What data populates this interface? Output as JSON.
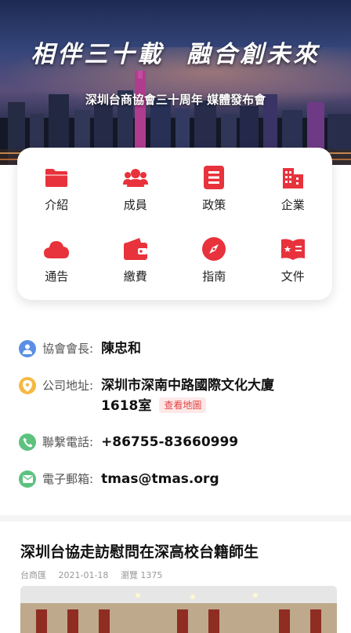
{
  "banner": {
    "title": "相伴三十載  融合創未來",
    "subtitle": "深圳台商協會三十周年 媒體發布會"
  },
  "menu": {
    "items": [
      {
        "label": "介紹",
        "icon": "folder-icon"
      },
      {
        "label": "成員",
        "icon": "members-icon"
      },
      {
        "label": "政策",
        "icon": "document-list-icon"
      },
      {
        "label": "企業",
        "icon": "building-icon"
      },
      {
        "label": "通告",
        "icon": "cloud-icon"
      },
      {
        "label": "繳費",
        "icon": "wallet-icon"
      },
      {
        "label": "指南",
        "icon": "compass-icon"
      },
      {
        "label": "文件",
        "icon": "book-icon"
      }
    ],
    "accent_color": "#e8323c"
  },
  "info": {
    "president_label": "協會會長:",
    "president_value": "陳忠和",
    "address_label": "公司地址:",
    "address_value": "深圳市深南中路國際文化大廈1618室",
    "map_link": "查看地圖",
    "phone_label": "聯繫電話:",
    "phone_value": "+86755-83660999",
    "email_label": "電子郵箱:",
    "email_value": "tmas@tmas.org"
  },
  "article": {
    "title": "深圳台協走訪慰問在深高校台籍師生",
    "source": "台商匯",
    "date": "2021-01-18",
    "views": "瀏覽 1375"
  }
}
